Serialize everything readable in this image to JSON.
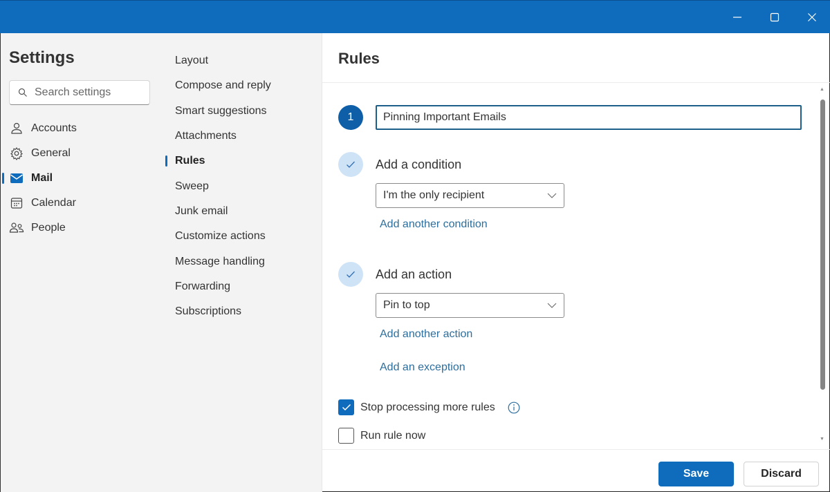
{
  "window": {
    "controls": {
      "minimize": "minimize-icon",
      "maximize": "maximize-icon",
      "close": "close-icon"
    },
    "accent_color": "#0f6cbd"
  },
  "settings_nav": {
    "title": "Settings",
    "search": {
      "placeholder": "Search settings",
      "value": ""
    },
    "items": [
      {
        "label": "Accounts",
        "icon": "person-icon",
        "active": false
      },
      {
        "label": "General",
        "icon": "gear-icon",
        "active": false
      },
      {
        "label": "Mail",
        "icon": "mail-icon",
        "active": true
      },
      {
        "label": "Calendar",
        "icon": "calendar-icon",
        "active": false
      },
      {
        "label": "People",
        "icon": "people-icon",
        "active": false
      }
    ]
  },
  "mail_nav": {
    "items": [
      {
        "label": "Layout"
      },
      {
        "label": "Compose and reply"
      },
      {
        "label": "Smart suggestions"
      },
      {
        "label": "Attachments"
      },
      {
        "label": "Rules",
        "active": true
      },
      {
        "label": "Sweep"
      },
      {
        "label": "Junk email"
      },
      {
        "label": "Customize actions"
      },
      {
        "label": "Message handling"
      },
      {
        "label": "Forwarding"
      },
      {
        "label": "Subscriptions"
      }
    ]
  },
  "rules": {
    "title": "Rules",
    "step_number": "1",
    "rule_name": "Pinning Important Emails",
    "condition": {
      "label": "Add a condition",
      "selected": "I'm the only recipient",
      "add_link": "Add another condition"
    },
    "action": {
      "label": "Add an action",
      "selected": "Pin to top",
      "add_link": "Add another action"
    },
    "exception_link": "Add an exception",
    "stop_processing": {
      "label": "Stop processing more rules",
      "checked": true
    },
    "run_now": {
      "label": "Run rule now",
      "checked": false
    },
    "save_label": "Save",
    "discard_label": "Discard"
  }
}
